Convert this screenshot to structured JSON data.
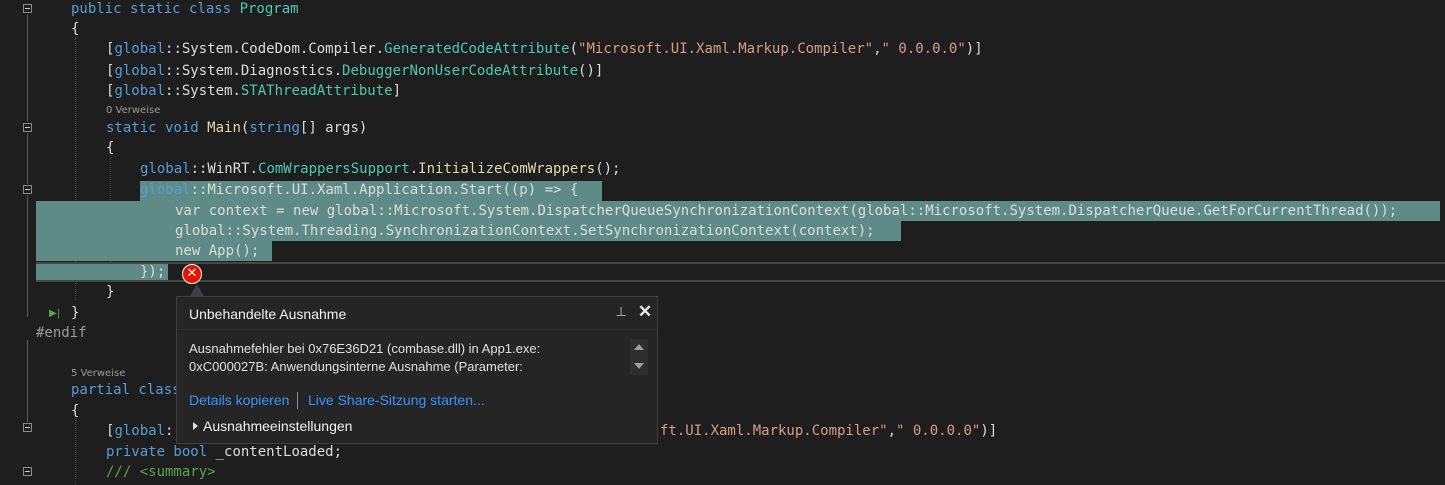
{
  "code": {
    "l1": [
      "public static class ",
      "Program"
    ],
    "l2": "{",
    "l3": [
      "[",
      "global",
      "::System.CodeDom.Compiler.",
      "GeneratedCodeAttribute",
      "(",
      "\"Microsoft.UI.Xaml.Markup.Compiler\"",
      ",",
      "\" 0.0.0.0\"",
      ")]"
    ],
    "l4": [
      "[",
      "global",
      "::System.Diagnostics.",
      "DebuggerNonUserCodeAttribute",
      "()]"
    ],
    "l5": [
      "[",
      "global",
      "::System.",
      "STAThreadAttribute",
      "]"
    ],
    "l6_lens": "0 Verweise",
    "l6": [
      "static void ",
      "Main",
      "(",
      "string",
      "[] args)"
    ],
    "l7": "{",
    "l8": [
      "global",
      "::WinRT.",
      "ComWrappersSupport",
      ".",
      "InitializeComWrappers",
      "();"
    ],
    "l9": [
      "global",
      "::Microsoft.UI.Xaml.Application.",
      "Start",
      "((p) => {"
    ],
    "l10": [
      "var",
      " context = ",
      "new",
      " ",
      "global",
      "::Microsoft.System.DispatcherQueueSynchronizationContext(",
      "global",
      "::Microsoft.System.DispatcherQueue.GetForCurrentThread());"
    ],
    "l11": [
      "global",
      "::System.Threading.SynchronizationContext.SetSynchronizationContext(context);"
    ],
    "l12": [
      "new",
      " App();"
    ],
    "l13": "});",
    "l14": "}",
    "l15": "}",
    "l16": "#endif",
    "l17_lens": "5 Verweise",
    "l17": [
      "partial class"
    ],
    "l18": "{",
    "l19a": [
      "[",
      "global",
      ":"
    ],
    "l19b": [
      "ft.UI.Xaml.Markup.Compiler\"",
      ",",
      "\" 0.0.0.0\"",
      ")]"
    ],
    "l20": [
      "private bool",
      " _contentLoaded;"
    ],
    "l21": "/// <summary>"
  },
  "popup": {
    "title": "Unbehandelte Ausnahme",
    "message_line1": "Ausnahmefehler bei 0x76E36D21 (combase.dll) in App1.exe:",
    "message_line2": "0xC000027B: Anwendungsinterne Ausnahme (Parameter:",
    "link_copy": "Details kopieren",
    "link_share": "Live Share-Sitzung starten...",
    "settings_label": "Ausnahmeeinstellungen"
  },
  "icons": {
    "error": "error-x-icon",
    "pin": "pin-icon",
    "close": "close-icon",
    "expand": "expand-triangle-icon"
  },
  "colors": {
    "keyword": "#569cd6",
    "type": "#4ec9b0",
    "string": "#d69d85",
    "method": "#dcdcaa",
    "selection": "#5f8b86",
    "error": "#e51400",
    "link": "#3794ff"
  }
}
